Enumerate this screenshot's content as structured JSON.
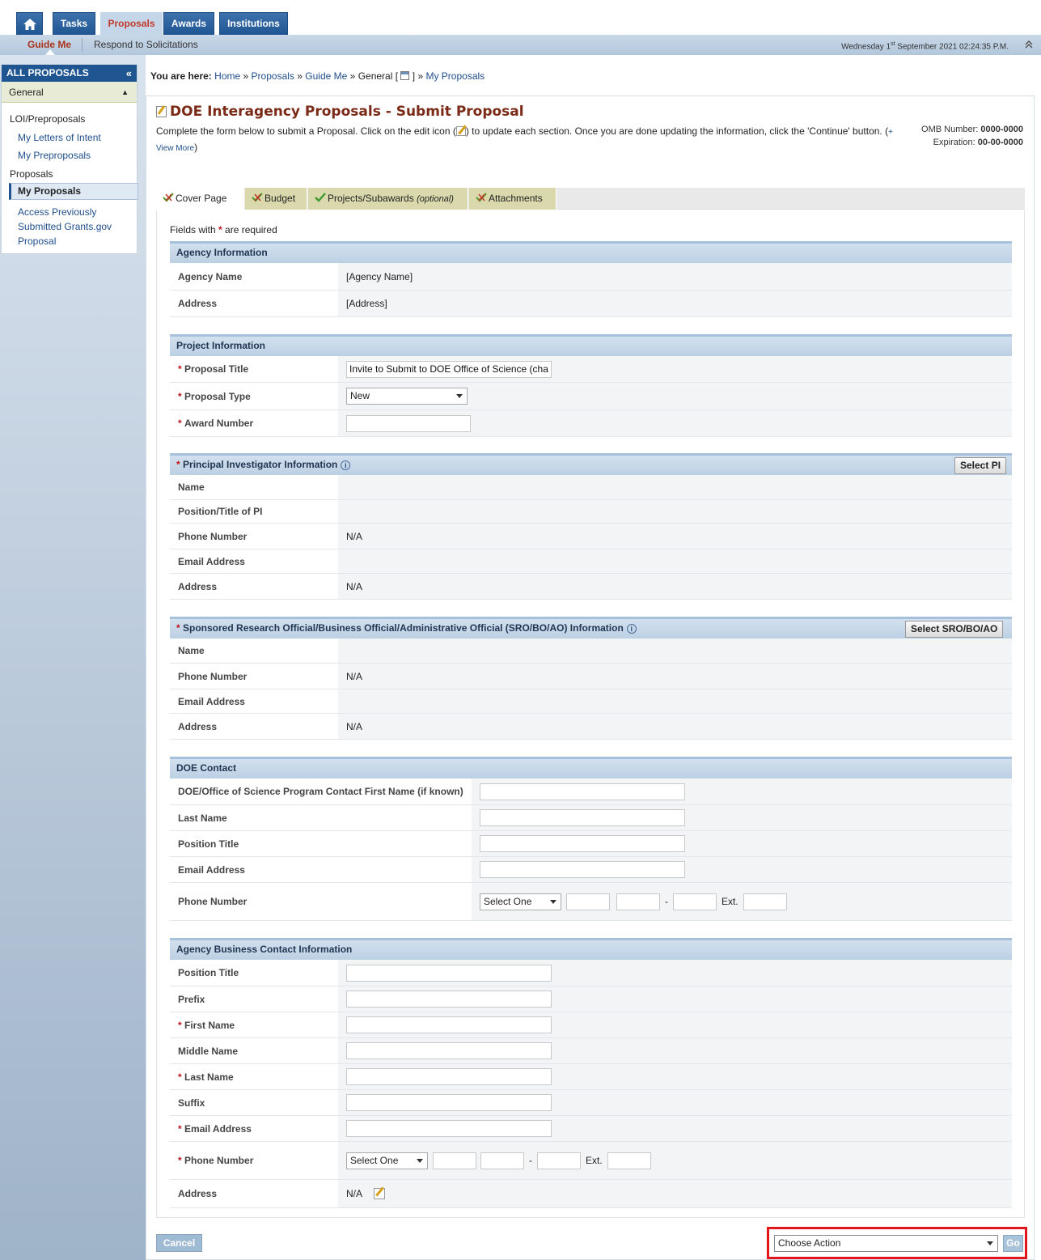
{
  "nav": {
    "tabs": [
      {
        "label": "Tasks"
      },
      {
        "label": "Proposals"
      },
      {
        "label": "Awards"
      },
      {
        "label": "Institutions"
      }
    ],
    "subnav": {
      "guide": "Guide Me",
      "respond": "Respond to Solicitations"
    },
    "clock_prefix": "Wednesday 1",
    "clock_sup": "st",
    "clock_suffix": " September 2021 02:24:35 P.M."
  },
  "sidebar": {
    "header": "ALL PROPOSALS",
    "collapse_glyph": "«",
    "group": "General",
    "sections": [
      {
        "title": "LOI/Preproposals",
        "links": [
          "My Letters of Intent",
          "My Preproposals"
        ]
      },
      {
        "title": "Proposals",
        "links": [
          "My Proposals",
          "Access Previously Submitted Grants.gov Proposal"
        ]
      }
    ],
    "access_line1": "Access Previously",
    "access_line2": "Submitted Grants.gov",
    "access_line3": "Proposal"
  },
  "breadcrumb": {
    "prefix": "You are here:",
    "home": "Home",
    "proposals": "Proposals",
    "guide": "Guide Me",
    "general": "General [",
    "general_end": "]",
    "mine": "My Proposals",
    "sep": "»"
  },
  "page": {
    "title": "DOE Interagency Proposals - Submit Proposal",
    "intro_a": "Complete the form below to submit a Proposal. Click on the edit icon (",
    "intro_b": ") to update each section. Once you are done updating the information, click the 'Continue' button. (",
    "view_more_plus": "+",
    "view_more": "View More",
    "intro_close": ")",
    "omb_label": "OMB Number:",
    "omb_value": "0000-0000",
    "exp_label": "Expiration:",
    "exp_value": "00-00-0000"
  },
  "form_tabs": [
    {
      "label": "Cover Page"
    },
    {
      "label": "Budget"
    },
    {
      "label": "Projects/Subawards",
      "suffix": "(optional)"
    },
    {
      "label": "Attachments"
    }
  ],
  "required_note": {
    "a": "Fields with",
    "b": "are required"
  },
  "agency": {
    "header": "Agency Information",
    "name_label": "Agency Name",
    "name_value": "[Agency Name]",
    "address_label": "Address",
    "address_value": "[Address]"
  },
  "project": {
    "header": "Project Information",
    "title_label": "Proposal Title",
    "title_value": "Invite to Submit to DOE Office of Science (char",
    "type_label": "Proposal Type",
    "type_value": "New",
    "award_label": "Award Number",
    "award_value": ""
  },
  "pi": {
    "header": "Principal Investigator Information",
    "button": "Select PI",
    "name_label": "Name",
    "name_value": "",
    "position_label": "Position/Title of PI",
    "position_value": "",
    "phone_label": "Phone Number",
    "phone_value": "N/A",
    "email_label": "Email Address",
    "email_value": "",
    "address_label": "Address",
    "address_value": "N/A"
  },
  "sro": {
    "header": "Sponsored Research Official/Business Official/Administrative Official (SRO/BO/AO) Information",
    "button": "Select SRO/BO/AO",
    "name_label": "Name",
    "name_value": "",
    "phone_label": "Phone Number",
    "phone_value": "N/A",
    "email_label": "Email Address",
    "email_value": "",
    "address_label": "Address",
    "address_value": "N/A"
  },
  "doe": {
    "header": "DOE Contact",
    "first_label": "DOE/Office of Science Program Contact First Name (if known)",
    "last_label": "Last Name",
    "position_label": "Position Title",
    "email_label": "Email Address",
    "phone_label": "Phone Number",
    "phone_select": "Select One",
    "ext_label": "Ext."
  },
  "business": {
    "header": "Agency Business Contact Information",
    "position_label": "Position Title",
    "prefix_label": "Prefix",
    "first_label": "First Name",
    "middle_label": "Middle Name",
    "last_label": "Last Name",
    "suffix_label": "Suffix",
    "email_label": "Email Address",
    "phone_label": "Phone Number",
    "phone_select": "Select One",
    "ext_label": "Ext.",
    "address_label": "Address",
    "address_value": "N/A"
  },
  "footer": {
    "cancel": "Cancel",
    "action_select": "Choose Action",
    "go": "Go"
  },
  "colors": {
    "nav_blue": "#1f5591",
    "title_brown": "#7a2a16",
    "required_red": "#c0141a",
    "highlight_red": "#e1161d"
  }
}
